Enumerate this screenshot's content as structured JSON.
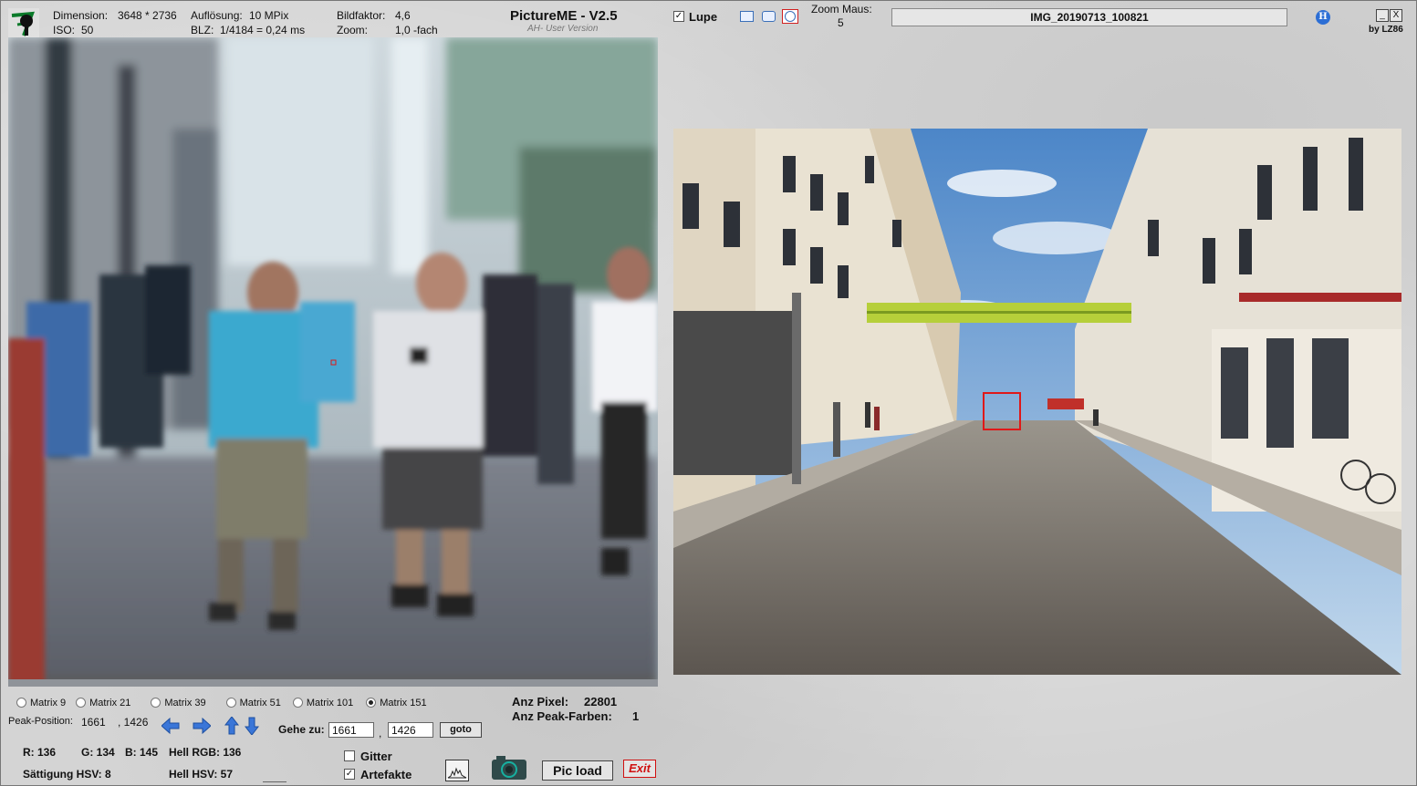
{
  "header": {
    "dimension_label": "Dimension:",
    "dimension_value": "3648 * 2736",
    "aufloesung_label": "Auflösung:",
    "aufloesung_value": "10 MPix",
    "bildfaktor_label": "Bildfaktor:",
    "bildfaktor_value": "4,6",
    "iso_label": "ISO:",
    "iso_value": "50",
    "blz_label": "BLZ:",
    "blz_value": "1/4184 = 0,24 ms",
    "zoom_label": "Zoom:",
    "zoom_value": "1,0 -fach",
    "app_title": "PictureME - V2.5",
    "app_subtitle": "AH- User Version",
    "lupe_label": "Lupe",
    "zoom_maus_label": "Zoom Maus:",
    "zoom_maus_value": "5",
    "filename": "IMG_20190713_100821",
    "h_button": "H",
    "minimize": "_",
    "close": "X",
    "byline": "by LZ86"
  },
  "matrix_options": [
    {
      "label": "Matrix 9",
      "selected": false
    },
    {
      "label": "Matrix 21",
      "selected": false
    },
    {
      "label": "Matrix 39",
      "selected": false
    },
    {
      "label": "Matrix 51",
      "selected": false
    },
    {
      "label": "Matrix 101",
      "selected": false
    },
    {
      "label": "Matrix 151",
      "selected": true
    }
  ],
  "stats": {
    "anz_pixel_label": "Anz Pixel:",
    "anz_pixel_value": "22801",
    "anz_peak_label": "Anz Peak-Farben:",
    "anz_peak_value": "1"
  },
  "peak": {
    "label": "Peak-Position:",
    "x": "1661",
    "y": ", 1426"
  },
  "goto": {
    "label": "Gehe zu:",
    "x_value": "1661",
    "sep": ",",
    "y_value": "1426",
    "button": "goto"
  },
  "color": {
    "r": "R: 136",
    "g": "G: 134",
    "b": "B: 145",
    "hell_rgb": "Hell RGB: 136",
    "saettigung": "Sättigung HSV:  8",
    "hell_hsv": "Hell HSV:  57"
  },
  "options": {
    "gitter_label": "Gitter",
    "gitter_checked": false,
    "artefakte_label": "Artefakte",
    "artefakte_checked": true
  },
  "buttons": {
    "pic_load": "Pic load",
    "exit": "Exit"
  },
  "icons": {
    "logo": "tree-logo-icon",
    "histogram": "histogram-icon",
    "camera": "camera-icon",
    "arrow_left": "arrow-left-icon",
    "arrow_right": "arrow-right-icon",
    "arrow_up": "arrow-up-icon",
    "arrow_down": "arrow-down-icon"
  },
  "colors": {
    "accent_blue": "#3a76d8",
    "exit_red": "#d01010",
    "selection_red": "#e01818"
  }
}
